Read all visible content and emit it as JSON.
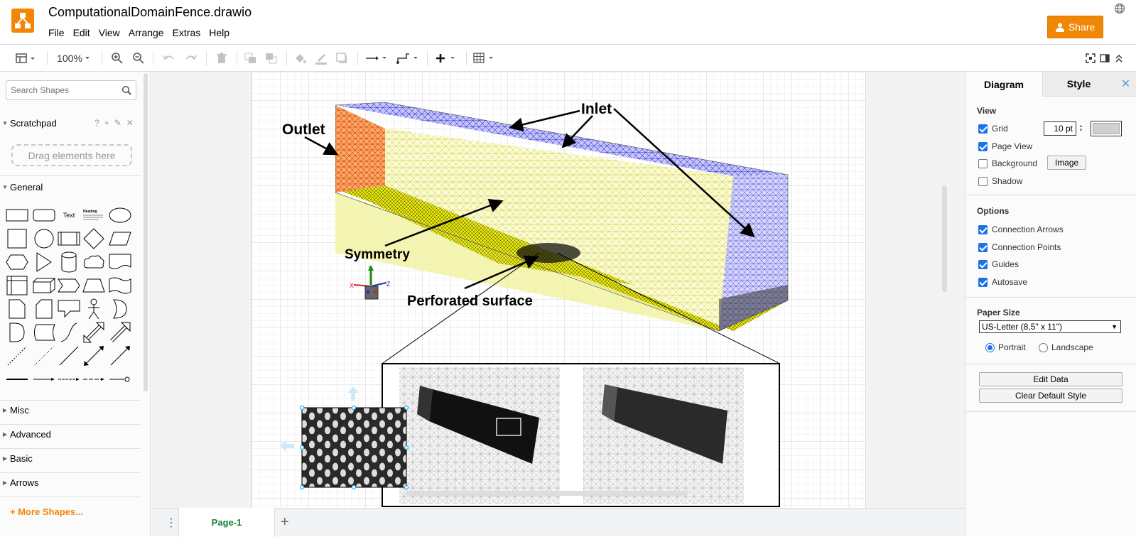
{
  "app": {
    "document_title": "ComputationalDomainFence.drawio",
    "menus": [
      "File",
      "Edit",
      "View",
      "Arrange",
      "Extras",
      "Help"
    ],
    "share_label": "Share",
    "brand_color": "#f08705"
  },
  "toolbar": {
    "zoom": "100%"
  },
  "sidebar": {
    "search_placeholder": "Search Shapes",
    "scratchpad_label": "Scratchpad",
    "scratchpad_tools": [
      "?",
      "+",
      "✎",
      "✕"
    ],
    "drag_area_label": "Drag elements here",
    "general_label": "General",
    "shape_text_label": "Text",
    "shape_heading_label": "Heading",
    "collapsed_sections": [
      "Misc",
      "Advanced",
      "Basic",
      "Arrows"
    ],
    "more_shapes_label": "More Shapes..."
  },
  "canvas": {
    "labels": {
      "outlet": "Outlet",
      "inlet": "Inlet",
      "symmetry": "Symmetry",
      "perforated": "Perforated surface"
    },
    "axis_labels": {
      "x": "X",
      "y": "Y",
      "z": "Z"
    }
  },
  "pages": {
    "tabs": [
      "Page-1"
    ]
  },
  "format_panel": {
    "tabs": {
      "diagram": "Diagram",
      "style": "Style"
    },
    "view_heading": "View",
    "view_options": [
      {
        "label": "Grid",
        "checked": true
      },
      {
        "label": "Page View",
        "checked": true
      },
      {
        "label": "Background",
        "checked": false
      },
      {
        "label": "Shadow",
        "checked": false
      }
    ],
    "grid_size": "10 pt",
    "image_button": "Image",
    "options_heading": "Options",
    "options": [
      {
        "label": "Connection Arrows",
        "checked": true
      },
      {
        "label": "Connection Points",
        "checked": true
      },
      {
        "label": "Guides",
        "checked": true
      },
      {
        "label": "Autosave",
        "checked": true
      }
    ],
    "paper_size_heading": "Paper Size",
    "paper_size_value": "US-Letter (8,5\" x 11\")",
    "orientation": {
      "portrait": "Portrait",
      "landscape": "Landscape",
      "selected": "portrait"
    },
    "edit_data_button": "Edit Data",
    "clear_style_button": "Clear Default Style"
  }
}
